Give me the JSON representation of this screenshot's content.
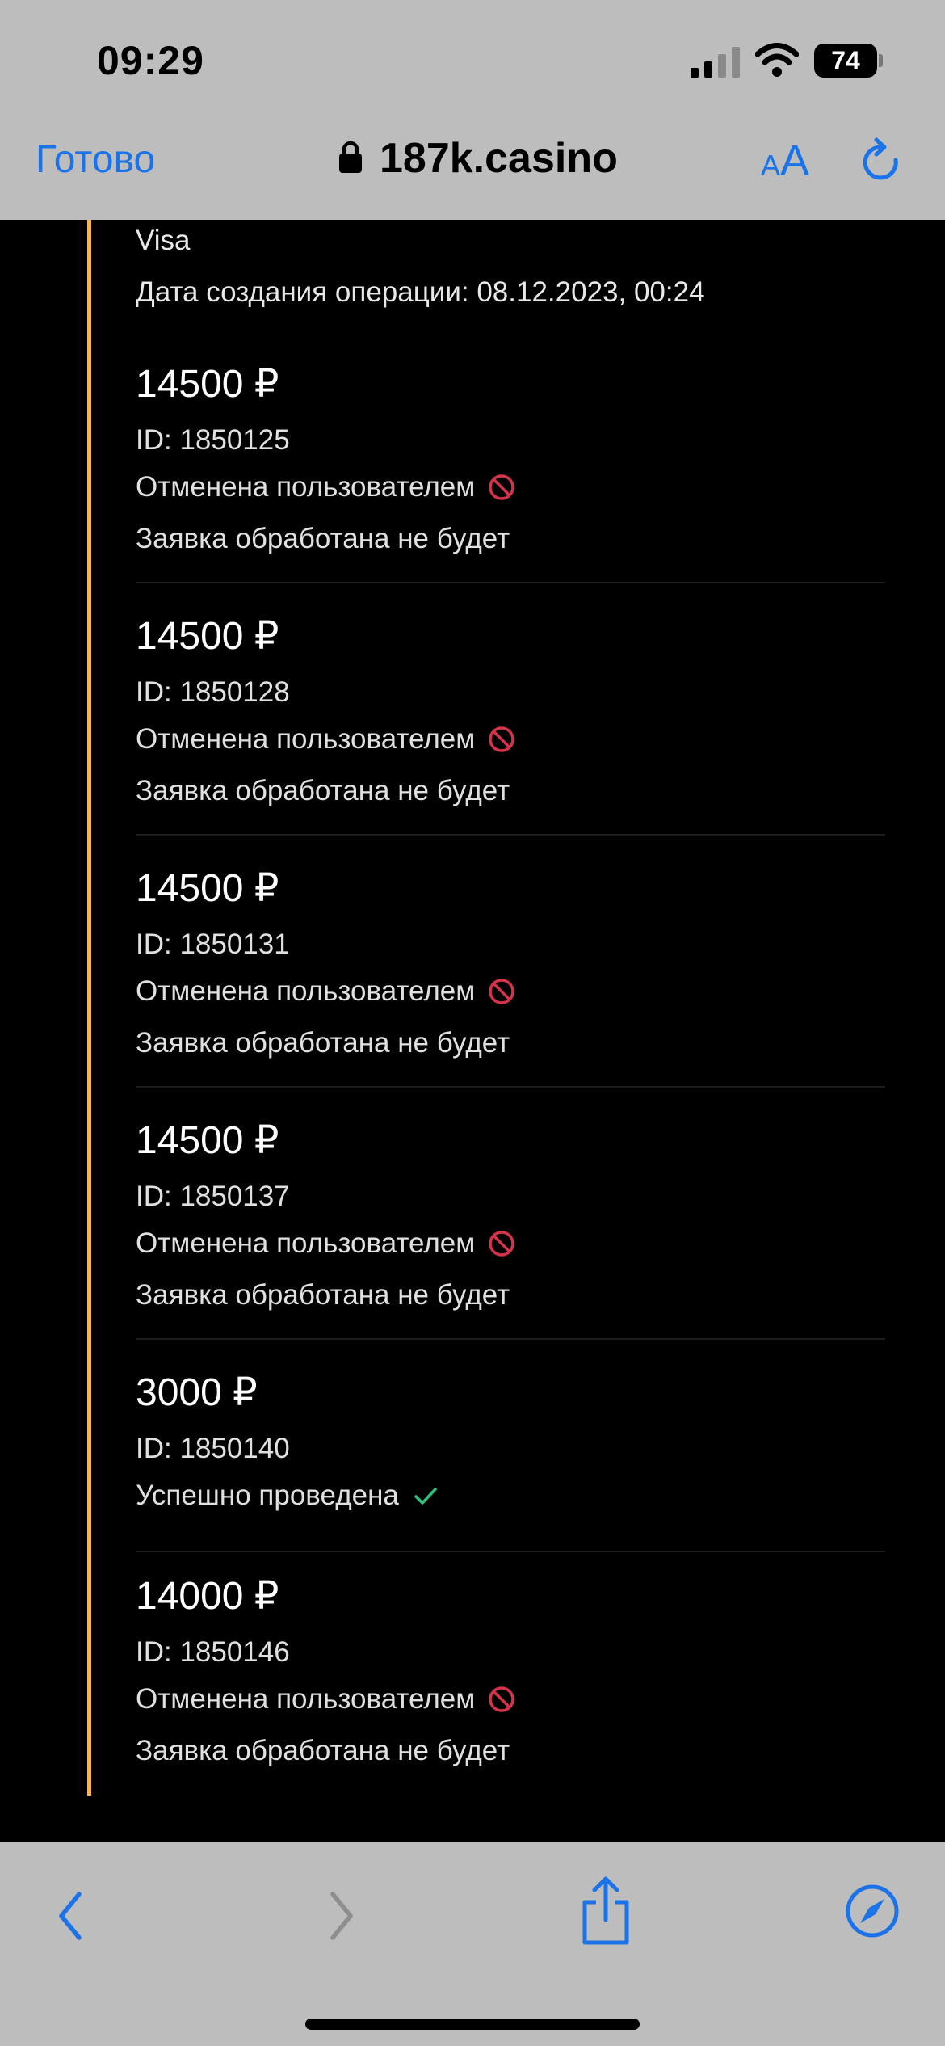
{
  "status_bar": {
    "time": "09:29",
    "battery": "74"
  },
  "browser": {
    "done_label": "Готово",
    "url": "187k.casino",
    "textsize_small": "A",
    "textsize_big": "A"
  },
  "previous": {
    "method": "Visa",
    "created": "Дата создания операции: 08.12.2023, 00:24"
  },
  "transactions": [
    {
      "amount": "14500 ₽",
      "id": "ID: 1850125",
      "status": "Отменена пользователем",
      "note": "Заявка обработана не будет"
    },
    {
      "amount": "14500 ₽",
      "id": "ID: 1850128",
      "status": "Отменена пользователем",
      "note": "Заявка обработана не будет"
    },
    {
      "amount": "14500 ₽",
      "id": "ID: 1850131",
      "status": "Отменена пользователем",
      "note": "Заявка обработана не будет"
    },
    {
      "amount": "14500 ₽",
      "id": "ID: 1850137",
      "status": "Отменена пользователем",
      "note": "Заявка обработана не будет"
    },
    {
      "amount": "3000 ₽",
      "id": "ID: 1850140",
      "status": "Успешно проведена"
    },
    {
      "amount": "14000 ₽",
      "id": "ID: 1850146",
      "status": "Отменена пользователем",
      "note": "Заявка обработана не будет"
    }
  ],
  "colors": {
    "accent": "#f3b556",
    "cancelled": "#d6334a",
    "success": "#2ec27e",
    "link": "#1a73e8"
  }
}
